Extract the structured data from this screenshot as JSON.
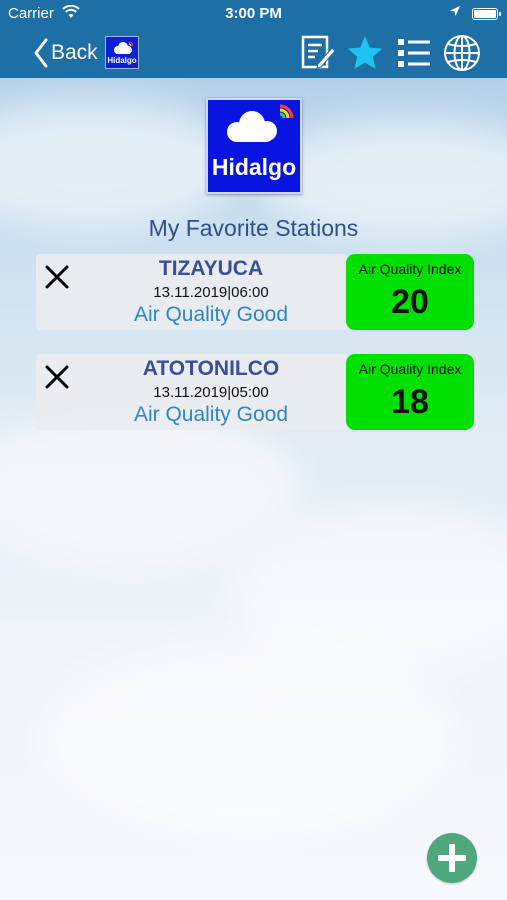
{
  "status_bar": {
    "carrier": "Carrier",
    "time": "3:00 PM"
  },
  "nav": {
    "back_label": "Back",
    "mini_logo_text": "Hidalgo",
    "icons": [
      "edit-icon",
      "star-icon",
      "list-icon",
      "globe-icon"
    ]
  },
  "logo": {
    "text": "Hidalgo"
  },
  "section_title": "My Favorite Stations",
  "stations": [
    {
      "name": "TIZAYUCA",
      "date": "13.11.2019|06:00",
      "status": "Air Quality Good",
      "aqi_label": "Air Quality Index",
      "aqi_value": "20"
    },
    {
      "name": "ATOTONILCO",
      "date": "13.11.2019|05:00",
      "status": "Air Quality Good",
      "aqi_label": "Air Quality Index",
      "aqi_value": "18"
    }
  ],
  "colors": {
    "nav_bar": "#1f6fa7",
    "aqi_good": "#00e000",
    "add_button": "#4fa77d",
    "station_name": "#3c4e96",
    "station_status": "#2d86c6"
  }
}
